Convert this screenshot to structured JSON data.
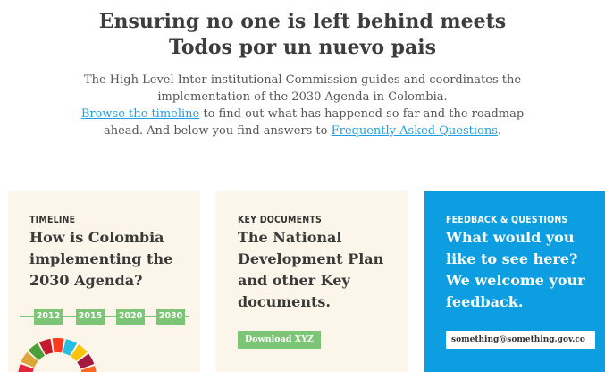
{
  "hero": {
    "title_line1": "Ensuring no one is left behind meets",
    "title_line2": "Todos por un nuevo pais",
    "intro_line1": "The High Level Inter-institutional Commission guides and coordinates the implementation of the 2030 Agenda in Colombia.",
    "timeline_link": "Browse the timeline",
    "intro_line2": " to find out what has happened so far and the roadmap ahead. And below you find answers to ",
    "faq_link": "Frequently Asked Questions",
    "intro_end": "."
  },
  "cards": [
    {
      "eyebrow": "TIMELINE",
      "title": "How is Colombia implementing the 2030 Agenda?",
      "years": [
        "2012",
        "2015",
        "2020",
        "2030"
      ]
    },
    {
      "eyebrow": "KEY DOCUMENTS",
      "title": "The National Development Plan and other Key documents.",
      "button": "Download XYZ"
    },
    {
      "eyebrow": "FEEDBACK & QUESTIONS",
      "title": "What would you like to see here? We welcome your feedback.",
      "email_value": "something@something.gov.co"
    }
  ],
  "colors": {
    "accent_blue": "#0d9ee2",
    "link_blue": "#1e9fe0",
    "green": "#7cc576",
    "cream": "#fbf6e9"
  },
  "icons": {
    "sdg_wheel": "sdg-color-wheel-icon"
  }
}
